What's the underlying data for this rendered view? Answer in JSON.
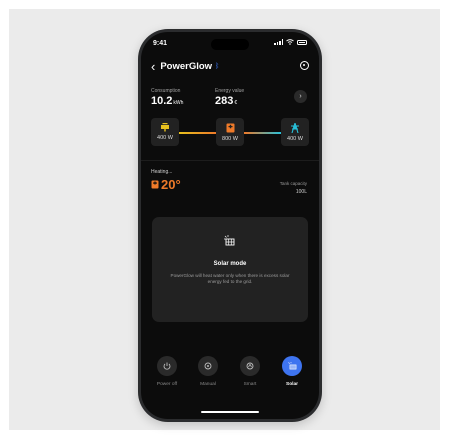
{
  "status": {
    "time": "9:41"
  },
  "nav": {
    "back_label": "‹",
    "title": "PowerGlow",
    "bt_symbol": "ᛒ"
  },
  "stats": {
    "consumption": {
      "label": "Consumption",
      "value": "10.2",
      "unit": "kWh"
    },
    "energy_value": {
      "label": "Energy value",
      "value": "283",
      "unit": "€"
    },
    "detail_symbol": "›"
  },
  "flow": {
    "solar": {
      "watts": "400 W",
      "color": "#e8c11e"
    },
    "heater": {
      "watts": "800 W",
      "color": "#ee7a29"
    },
    "grid": {
      "watts": "400 W",
      "color": "#27c0d9"
    }
  },
  "heating": {
    "label": "Heating...",
    "temperature": "20°",
    "tank_label": "Tank capacity",
    "tank_value": "100L"
  },
  "mode_card": {
    "title": "Solar mode",
    "description": "PowerGlow will heat water only when there is excess solar energy fed to the grid."
  },
  "modes": [
    {
      "label": "Power off",
      "icon": "power-icon",
      "active": false
    },
    {
      "label": "Manual",
      "icon": "manual-icon",
      "active": false
    },
    {
      "label": "Smart",
      "icon": "smart-icon",
      "active": false
    },
    {
      "label": "Solar",
      "icon": "solar-icon",
      "active": true
    }
  ],
  "colors": {
    "accent": "#3e74f0",
    "heat": "#ee7a29",
    "solar": "#e8c11e",
    "grid": "#27c0d9"
  }
}
